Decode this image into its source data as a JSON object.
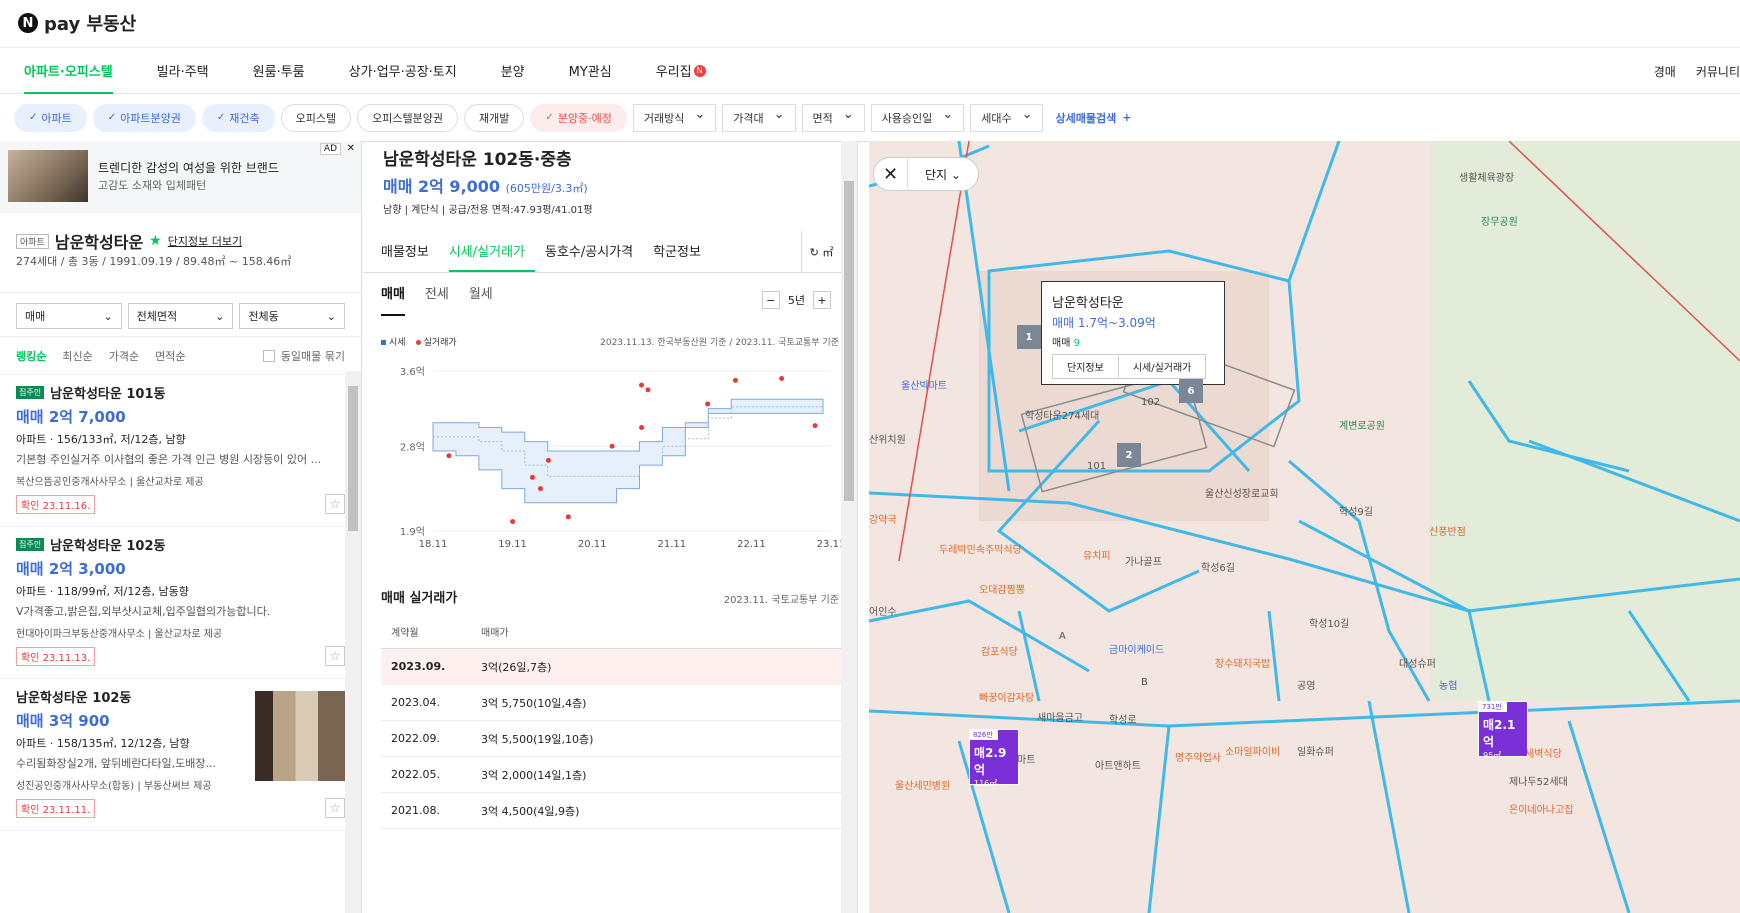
{
  "brand": {
    "logo_letter": "N",
    "name": "pay 부동산"
  },
  "nav": {
    "items": [
      "아파트·오피스텔",
      "빌라·주택",
      "원룸·투룸",
      "상가·업무·공장·토지",
      "분양",
      "MY관심",
      "우리집"
    ],
    "active": 0,
    "new_badge": "N",
    "right": [
      "경매",
      "커뮤니티"
    ]
  },
  "filters": {
    "chips": [
      "아파트",
      "아파트분양권",
      "재건축",
      "오피스텔",
      "오피스텔분양권",
      "재개발",
      "분양중·예정"
    ],
    "chip_states": [
      "on",
      "on",
      "on",
      "off",
      "off",
      "off",
      "red"
    ],
    "dropdowns": [
      "거래방식",
      "가격대",
      "면적",
      "사용승인일",
      "세대수"
    ],
    "detail_search": "상세매물검색",
    "detail_icon": "+"
  },
  "ad": {
    "line1": "트렌디한 감성의 여성을 위한 브랜드",
    "line2": "고감도 소재와 입체패턴",
    "tag": "AD",
    "close": "✕"
  },
  "complex": {
    "type": "아파트",
    "name": "남운학성타운",
    "star": "★",
    "more": "단지정보 더보기",
    "sub": "274세대 / 총 3동 / 1991.09.19 / 89.48㎡ ~ 158.46㎡"
  },
  "selects": [
    "매매",
    "전체면적",
    "전체동"
  ],
  "sorts": {
    "items": [
      "랭킹순",
      "최신순",
      "가격순",
      "면적순"
    ],
    "same": "동일매물 묶기"
  },
  "listings": [
    {
      "badge": "집주인",
      "title": "남운학성타운 101동",
      "price": "매매 2억 7,000",
      "spec": "아파트 · 156/133㎡, 저/12층, 남향",
      "desc": "기본형 주인실거주 이사협의 좋은 가격 인근 병원 시장등이 있어 ...",
      "agent": "복산으뜸공인중개사사무소 | 울산교차로 제공",
      "confirm": "확인 23.11.16."
    },
    {
      "badge": "집주인",
      "title": "남운학성타운 102동",
      "price": "매매 2억 3,000",
      "spec": "아파트 · 118/99㎡, 저/12층, 남동향",
      "desc": "V가격좋고,밝은집,외부샷시교체,입주일협의가능합니다.",
      "agent": "현대아이파크부동산중개사무소 | 울산교차로 제공",
      "confirm": "확인 23.11.13."
    },
    {
      "badge": "",
      "title": "남운학성타운 102동",
      "price": "매매 3억 900",
      "spec": "아파트 · 158/135㎡, 12/12층, 남향",
      "desc": "수리됨화장실2개, 앞뒤베란다타일,도배장...",
      "agent": "성진공인중개사사무소(합동) | 부동산써브 제공",
      "confirm": "확인 23.11.11."
    }
  ],
  "detail": {
    "title": "남운학성타운 102동·중층",
    "price": "매매 2억 9,000",
    "price_per": "(605만원/3.3㎡)",
    "meta": "남향 | 계단식 | 공급/전용 면적:47.93평/41.01평",
    "tabs": [
      "매물정보",
      "시세/실거래가",
      "동호수/공시가격",
      "학군정보"
    ],
    "active_tab": 1,
    "unit": "↻ ㎡",
    "subtabs": [
      "매매",
      "전세",
      "월세"
    ],
    "period": "5년",
    "minus": "−",
    "plus": "+",
    "legend": {
      "series1": "시세",
      "series2": "실거래가"
    },
    "source": "2023.11.13. 한국부동산원 기준 / 2023.11. 국토교통부 기준",
    "table_title": "매매 실거래가",
    "table_source": "2023.11. 국토교통부 기준",
    "table_headers": [
      "계약월",
      "매매가"
    ],
    "table_rows": [
      [
        "2023.09.",
        "3억(26일,7층)"
      ],
      [
        "2023.04.",
        "3억 5,750(10일,4층)"
      ],
      [
        "2022.09.",
        "3억 5,500(19일,10층)"
      ],
      [
        "2022.05.",
        "3억 2,000(14일,1층)"
      ],
      [
        "2021.08.",
        "3억 4,500(4일,9층)"
      ]
    ]
  },
  "chart_data": {
    "type": "line",
    "x_ticks": [
      "18.11",
      "19.11",
      "20.11",
      "21.11",
      "22.11",
      "23.11"
    ],
    "y_ticks": [
      "3.6억",
      "2.8억",
      "1.9억"
    ],
    "ylim": [
      1.9,
      3.6
    ],
    "series": [
      {
        "name": "시세",
        "band_low": [
          2.75,
          2.75,
          2.7,
          2.55,
          2.35,
          2.2,
          2.2,
          2.2,
          2.2,
          2.35,
          2.6,
          2.7,
          3.0,
          3.15,
          3.15,
          3.15,
          3.15,
          3.15
        ],
        "band_high": [
          3.05,
          3.05,
          3.0,
          2.95,
          2.85,
          2.75,
          2.75,
          2.75,
          2.75,
          2.85,
          3.0,
          3.05,
          3.2,
          3.3,
          3.3,
          3.3,
          3.3,
          3.3
        ],
        "mid": [
          2.9,
          2.9,
          2.85,
          2.75,
          2.6,
          2.48,
          2.48,
          2.48,
          2.48,
          2.6,
          2.8,
          2.88,
          3.1,
          3.22,
          3.22,
          3.22,
          3.22,
          3.22
        ]
      },
      {
        "name": "실거래가",
        "points": [
          [
            0.2,
            2.7
          ],
          [
            1.25,
            2.47
          ],
          [
            1.35,
            2.35
          ],
          [
            1.45,
            2.65
          ],
          [
            1.0,
            2.0
          ],
          [
            1.7,
            2.05
          ],
          [
            2.25,
            2.8
          ],
          [
            2.62,
            3.45
          ],
          [
            2.7,
            3.4
          ],
          [
            2.62,
            3.0
          ],
          [
            3.45,
            3.25
          ],
          [
            3.8,
            3.5
          ],
          [
            4.38,
            3.52
          ],
          [
            4.8,
            3.02
          ]
        ]
      }
    ]
  },
  "map": {
    "mode": "단지",
    "popup": {
      "name": "남운학성타운",
      "price": "매매 1.7억~3.09억",
      "count_label": "매매",
      "count": "9",
      "btn1": "단지정보",
      "btn2": "시세/실거래가"
    },
    "pins": [
      "1",
      "6",
      "2"
    ],
    "labels": [
      "생활체육광장",
      "장무공원",
      "울산빅마트",
      "계변로공원",
      "울산신성장로교회",
      "신풍반점",
      "강약국",
      "두레박민속주막식당",
      "유치피",
      "가나골프",
      "오대감짬뽕",
      "학성6길",
      "학성9길",
      "학성10길",
      "금마이케이드",
      "감포식당",
      "장수돼지국밥",
      "공영",
      "대성슈퍼",
      "농협",
      "빠꿍이감자탕",
      "A",
      "B",
      "새마을금고",
      "학성로",
      "명주약업사",
      "소마일파이비",
      "일화슈퍼",
      "아트앤하트",
      "세벽식당",
      "울산세민병원",
      "제나두52세대",
      "은이네아나고집",
      "101",
      "102",
      "학성타운274세대",
      "산위치원",
      "어인수",
      "마트"
    ],
    "pins_price": [
      {
        "top": "826만",
        "value": "매2.9억",
        "area": "116㎡"
      },
      {
        "top": "731만",
        "value": "매2.1억",
        "area": "95㎡"
      }
    ]
  }
}
